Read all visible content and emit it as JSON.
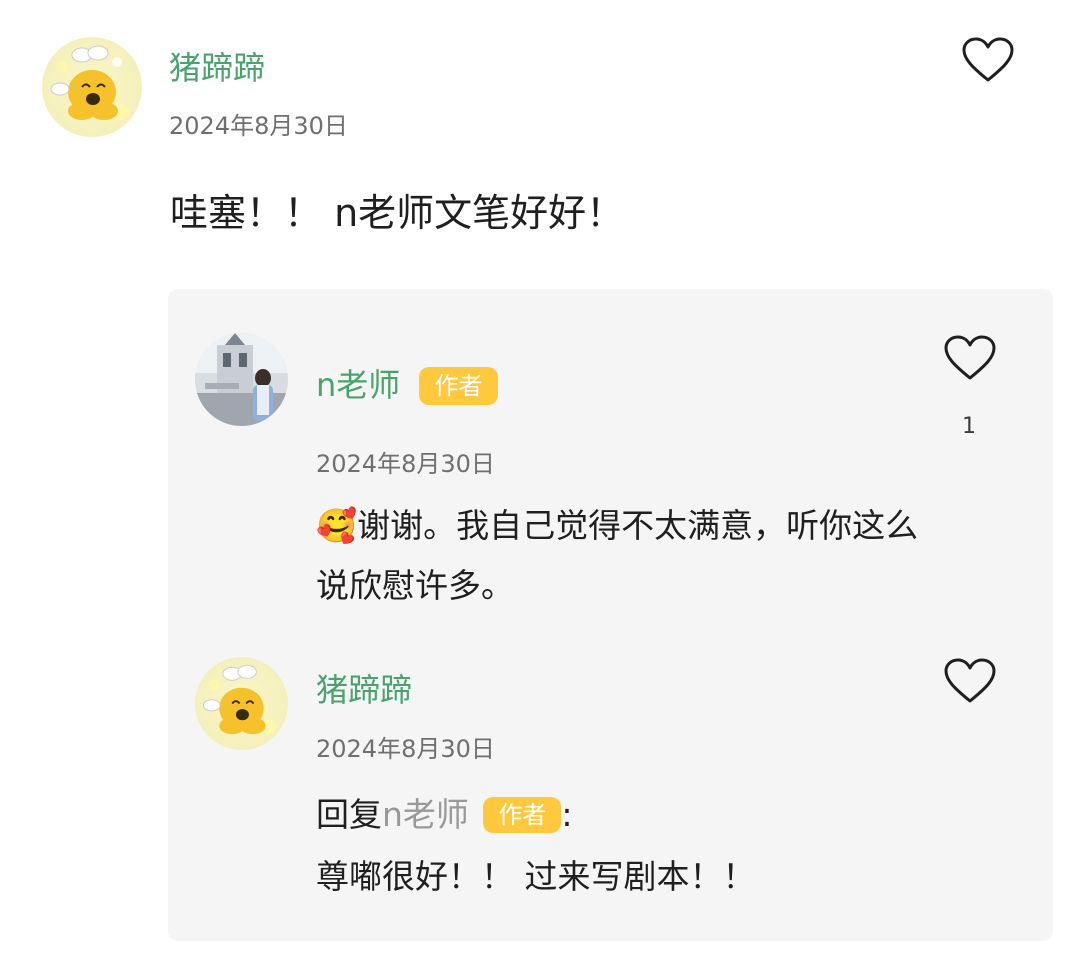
{
  "comment": {
    "username": "猪蹄蹄",
    "date": "2024年8月30日",
    "text": "哇塞！！ n老师文笔好好！",
    "avatar_icon": "cartoon-duck-avatar-icon"
  },
  "replies": [
    {
      "username": "n老师",
      "badge": "作者",
      "like_count": "1",
      "date": "2024年8月30日",
      "emoji": "🥰",
      "text_line1": "谢谢。我自己觉得不太满意，听你这么",
      "text_line2": "说欣慰许多。",
      "avatar_icon": "photo-avatar-icon"
    },
    {
      "username": "猪蹄蹄",
      "date": "2024年8月30日",
      "reply_prefix": "回复",
      "reply_target": "n老师",
      "reply_badge": "作者",
      "reply_colon": ":",
      "text": "尊嘟很好！！ 过来写剧本！！",
      "avatar_icon": "cartoon-duck-avatar-icon"
    }
  ],
  "colors": {
    "username": "#4aa36f",
    "badge": "#ffc93d",
    "reply_bg": "#f5f5f5",
    "date": "#6f6f6f"
  }
}
